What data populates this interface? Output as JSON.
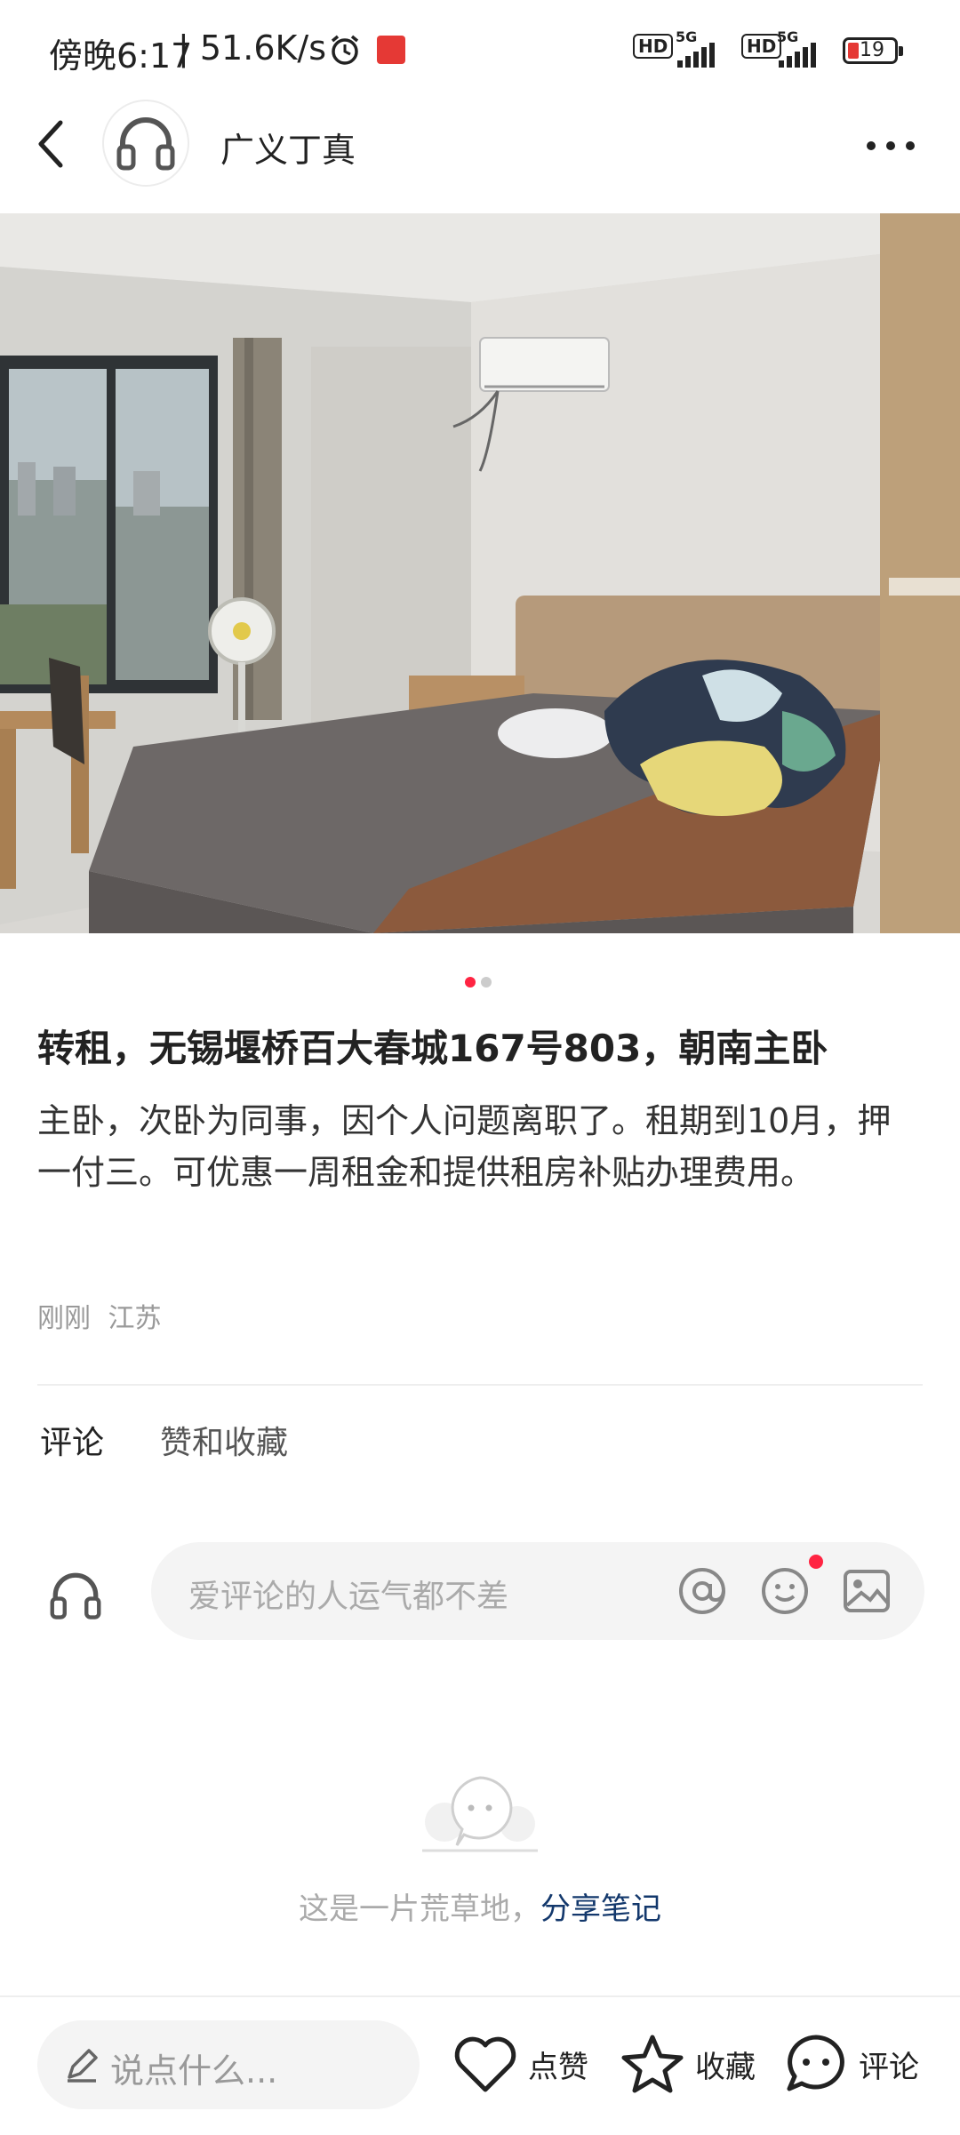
{
  "status_bar": {
    "time": "傍晚6:17",
    "network_speed": "| 51.6K/s",
    "hd1": "HD",
    "net1": "5G",
    "hd2": "HD",
    "net2": "5G",
    "battery": "19"
  },
  "header": {
    "username": "广义丁真",
    "more": "···"
  },
  "carousel": {
    "current": 1,
    "total": 2
  },
  "note": {
    "title": "转租，无锡堰桥百大春城167号803，朝南主卧",
    "body": "主卧，次卧为同事，因个人问题离职了。租期到10月，押一付三。可优惠一周租金和提供租房补贴办理费用。",
    "time": "刚刚",
    "location": "江苏"
  },
  "tabs": {
    "comments": "评论",
    "likes_collects": "赞和收藏"
  },
  "comment_input": {
    "placeholder": "爱评论的人运气都不差"
  },
  "empty_state": {
    "text": "这是一片荒草地，",
    "link": "分享笔记"
  },
  "bottom_bar": {
    "say_placeholder": "说点什么...",
    "like": "点赞",
    "collect": "收藏",
    "comment": "评论"
  },
  "colors": {
    "accent": "#ff2442",
    "link": "#13386c"
  }
}
